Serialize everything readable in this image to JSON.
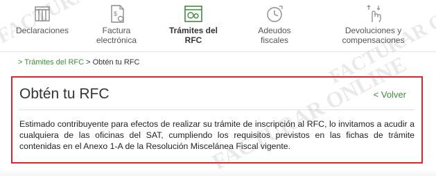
{
  "nav": {
    "items": [
      {
        "label_lines": [
          "Declaraciones"
        ],
        "icon": "columns-building-icon",
        "active": false
      },
      {
        "label_lines": [
          "Factura",
          "electrónica"
        ],
        "icon": "invoice-document-icon",
        "active": false
      },
      {
        "label_lines": [
          "Trámites del",
          "RFC"
        ],
        "icon": "rfc-certificate-icon",
        "active": true
      },
      {
        "label_lines": [
          "Adeudos",
          "fiscales"
        ],
        "icon": "debt-clock-icon",
        "active": false
      },
      {
        "label_lines": [
          "Devoluciones y",
          "compensaciones"
        ],
        "icon": "hand-touch-icon",
        "active": false
      }
    ]
  },
  "breadcrumb": {
    "prefix": "> ",
    "link": "Trámites del RFC",
    "separator": " > ",
    "current": "Obtén tu RFC"
  },
  "card": {
    "title": "Obtén tu RFC",
    "back_label": "< Volver",
    "body": "Estimado contribuyente para efectos de realizar su trámite de inscripción al RFC, lo invitamos a acudir a cualquiera de las oficinas del SAT, cumpliendo los requisitos previstos en las fichas de trámite contenidas en el Anexo 1-A de la Resolución Miscelánea Fiscal vigente."
  },
  "watermark": {
    "text": "FACTURAR ONLINE"
  },
  "colors": {
    "accent_green": "#3e8c3e",
    "highlight_red": "#e0242c",
    "icon_gray": "#8a8a8a"
  }
}
